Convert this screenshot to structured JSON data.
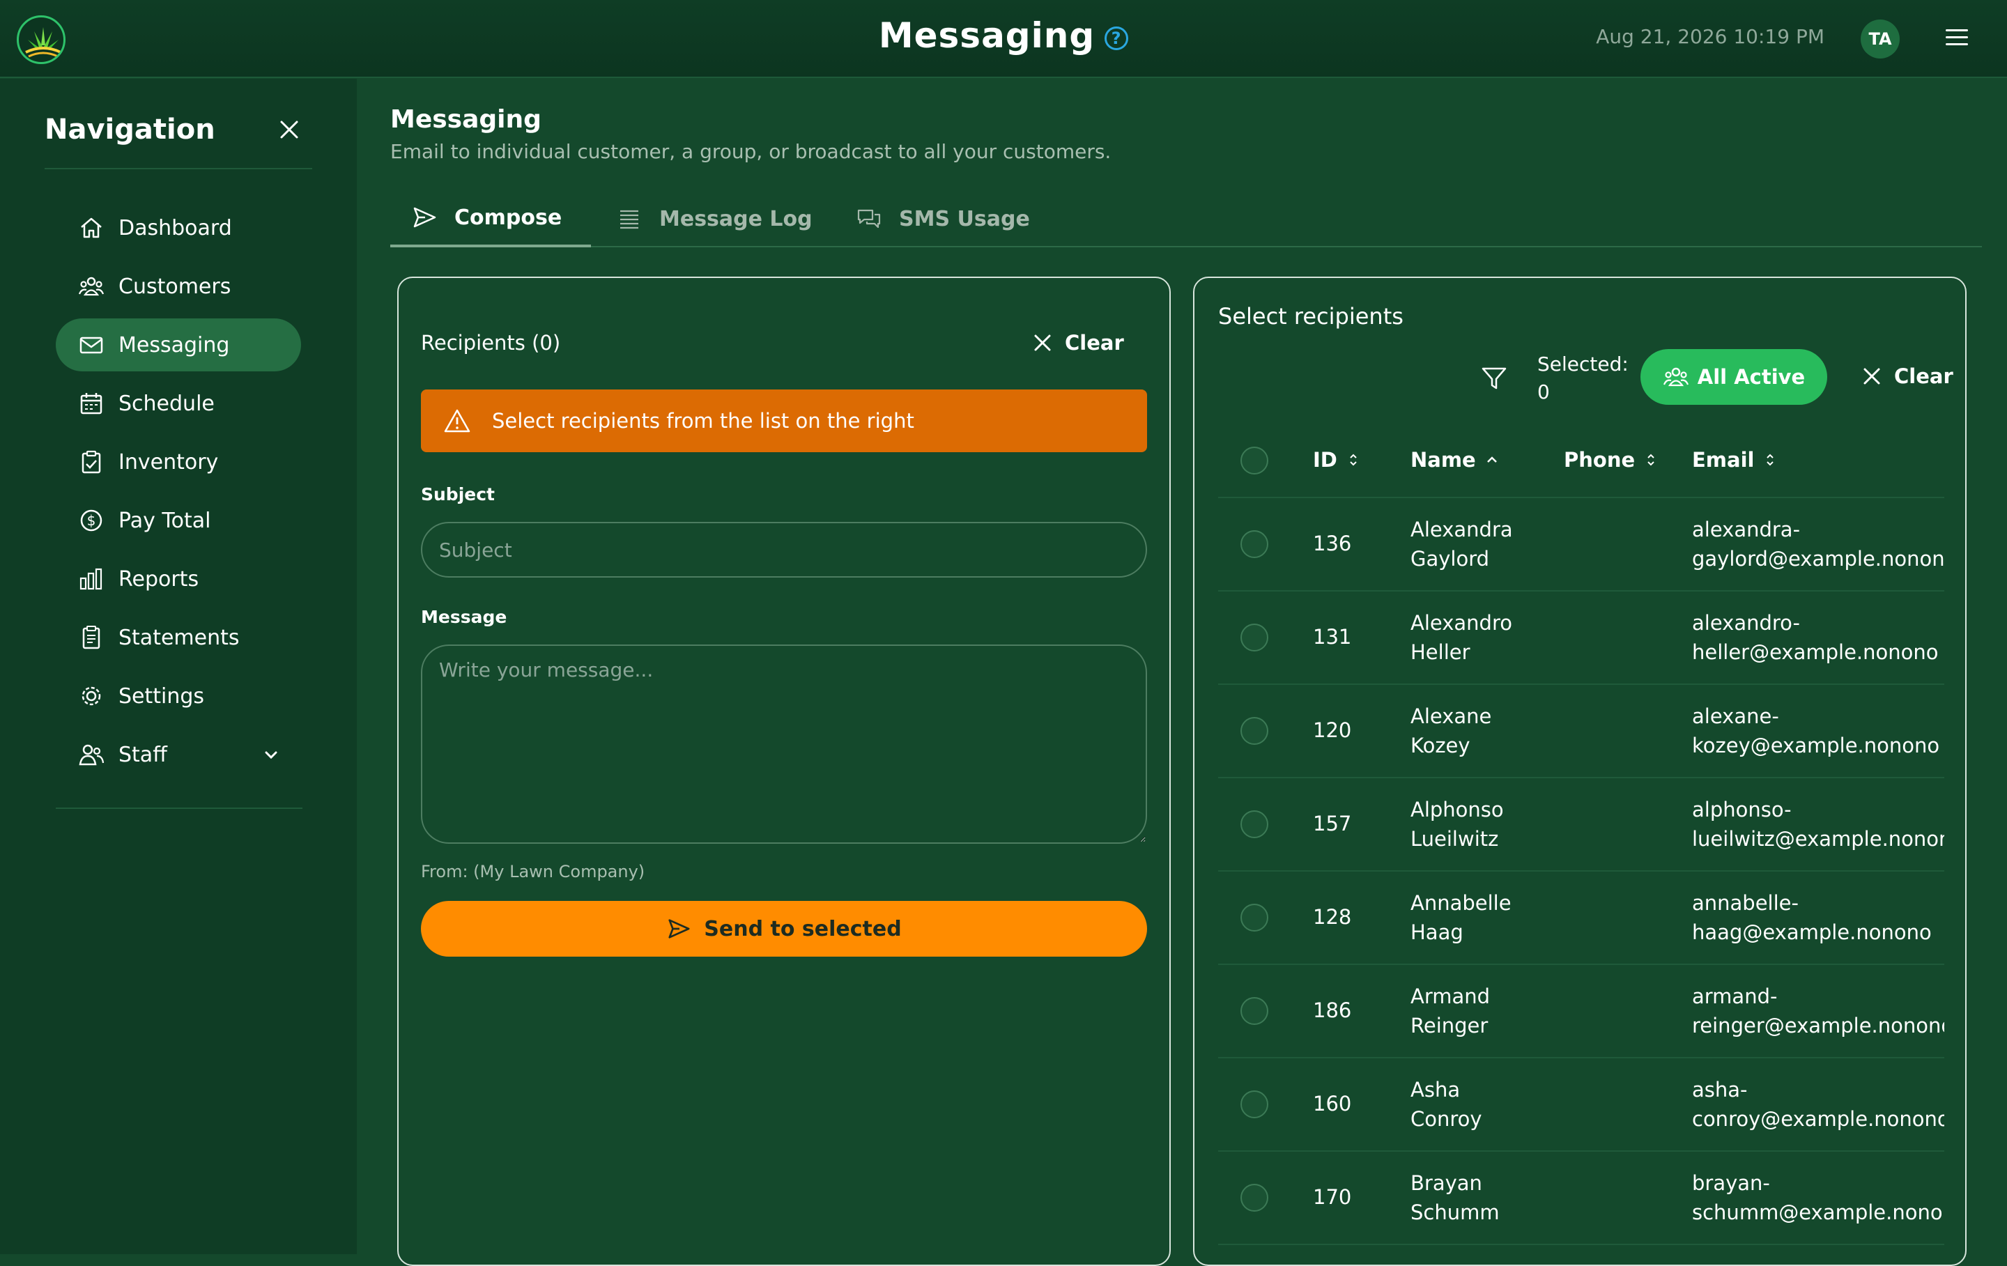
{
  "header": {
    "title": "Messaging",
    "help_icon": "?",
    "datetime": "Aug 21, 2026 10:19 PM",
    "avatar_initials": "TA"
  },
  "sidebar": {
    "title": "Navigation",
    "items": [
      {
        "label": "Dashboard",
        "icon": "home-icon"
      },
      {
        "label": "Customers",
        "icon": "users-icon"
      },
      {
        "label": "Messaging",
        "icon": "mail-icon",
        "active": true
      },
      {
        "label": "Schedule",
        "icon": "calendar-icon"
      },
      {
        "label": "Inventory",
        "icon": "clipboard-check-icon"
      },
      {
        "label": "Pay Total",
        "icon": "dollar-circle-icon"
      },
      {
        "label": "Reports",
        "icon": "bar-chart-icon"
      },
      {
        "label": "Statements",
        "icon": "documents-icon"
      },
      {
        "label": "Settings",
        "icon": "gear-icon"
      },
      {
        "label": "Staff",
        "icon": "staff-icon"
      }
    ]
  },
  "main": {
    "title": "Messaging",
    "subtitle": "Email to individual customer, a group, or broadcast to all your customers.",
    "tabs": [
      {
        "label": "Compose",
        "active": true
      },
      {
        "label": "Message Log"
      },
      {
        "label": "SMS Usage"
      }
    ]
  },
  "compose": {
    "recipients_label": "Recipients (0)",
    "clear_label": "Clear",
    "warning": "Select recipients from the list on the right",
    "subject_label": "Subject",
    "subject_placeholder": "Subject",
    "message_label": "Message",
    "message_placeholder": "Write your message...",
    "from": "From: (My Lawn Company)",
    "send_label": "Send to selected"
  },
  "recipients": {
    "title": "Select recipients",
    "selected_label": "Selected:",
    "selected_count": "0",
    "all_active_label": "All Active",
    "clear_label": "Clear",
    "columns": {
      "id": "ID",
      "name": "Name",
      "phone": "Phone",
      "email": "Email"
    },
    "rows": [
      {
        "id": "136",
        "first": "Alexandra",
        "last": "Gaylord",
        "email1": "alexandra-",
        "email2": "gaylord@example.nonono"
      },
      {
        "id": "131",
        "first": "Alexandro",
        "last": "Heller",
        "email1": "alexandro-",
        "email2": "heller@example.nonono"
      },
      {
        "id": "120",
        "first": "Alexane",
        "last": "Kozey",
        "email1": "alexane-",
        "email2": "kozey@example.nonono"
      },
      {
        "id": "157",
        "first": "Alphonso",
        "last": "Lueilwitz",
        "email1": "alphonso-",
        "email2": "lueilwitz@example.nonono"
      },
      {
        "id": "128",
        "first": "Annabelle",
        "last": "Haag",
        "email1": "annabelle-",
        "email2": "haag@example.nonono"
      },
      {
        "id": "186",
        "first": "Armand",
        "last": "Reinger",
        "email1": "armand-",
        "email2": "reinger@example.nonono"
      },
      {
        "id": "160",
        "first": "Asha",
        "last": "Conroy",
        "email1": "asha-",
        "email2": "conroy@example.nonono"
      },
      {
        "id": "170",
        "first": "Brayan",
        "last": "Schumm",
        "email1": "brayan-",
        "email2": "schumm@example.nonono"
      }
    ]
  },
  "colors": {
    "background": "#14492c",
    "sidebar": "#0f3d25",
    "active_nav": "#256e43",
    "warning": "#dc6b03",
    "send_button": "#ff8c00",
    "all_active_button": "#28bb5c",
    "help_icon": "#2aa7e0"
  }
}
